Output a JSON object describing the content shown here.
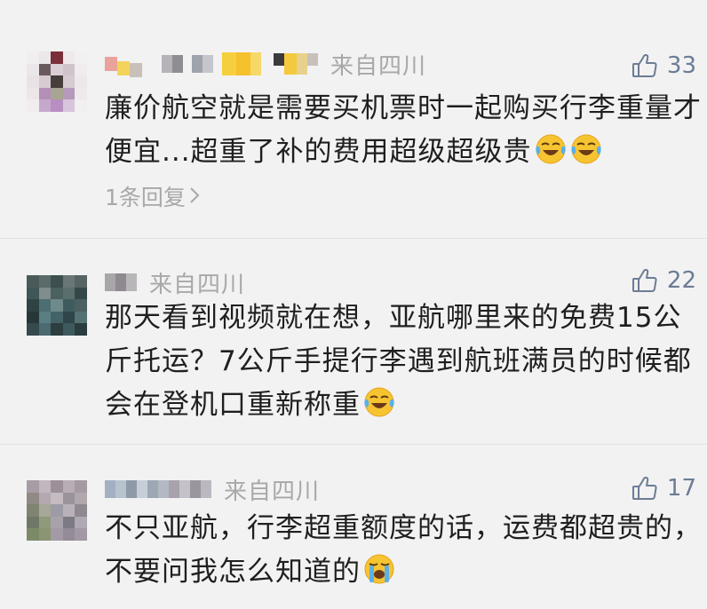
{
  "comments": [
    {
      "location": "来自四川",
      "likes": "33",
      "text": "廉价航空就是需要买机票时一起购买行李重量才便宜...超重了补的费用超级超级贵",
      "emojis": [
        "laugh-cry-emoji",
        "laugh-cry-emoji"
      ],
      "replies": "1条回复"
    },
    {
      "location": "来自四川",
      "likes": "22",
      "text": "那天看到视频就在想，亚航哪里来的免费15公斤托运？7公斤手提行李遇到航班满员的时候都会在登机口重新称重",
      "emojis": [
        "laugh-cry-emoji"
      ]
    },
    {
      "location": "来自四川",
      "likes": "17",
      "text": "不只亚航，行李超重额度的话，运费都超贵的，不要问我怎么知道的",
      "emojis": [
        "loud-cry-emoji"
      ]
    }
  ],
  "colors": {
    "background": "#f2f2f2",
    "text": "#1f1f1f",
    "meta": "#a8a8a8",
    "like_icon": "#6c7c95",
    "emoji_yellow": "#f7c431"
  }
}
